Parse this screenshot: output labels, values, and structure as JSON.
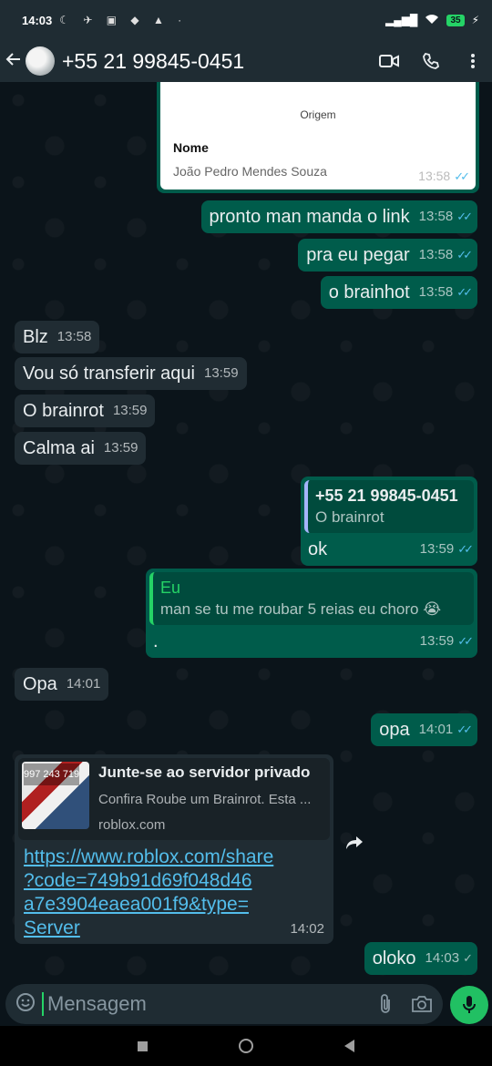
{
  "status_bar": {
    "time": "14:03",
    "battery": "35"
  },
  "header": {
    "contact_name": "+55 21 99845-0451"
  },
  "image_message": {
    "origem_label": "Origem",
    "nome_label": "Nome",
    "nome_value": "João Pedro Mendes Souza",
    "time": "13:58"
  },
  "messages": [
    {
      "text": "pronto man manda o link",
      "time": "13:58",
      "status": "✓✓"
    },
    {
      "text": "pra eu pegar",
      "time": "13:58",
      "status": "✓✓"
    },
    {
      "text": "o brainhot",
      "time": "13:58",
      "status": "✓✓"
    },
    {
      "text": "Blz",
      "time": "13:58"
    },
    {
      "text": "Vou só transferir aqui",
      "time": "13:59"
    },
    {
      "text": "O brainrot",
      "time": "13:59"
    },
    {
      "text": "Calma ai",
      "time": "13:59"
    },
    {
      "quote_name": "+55 21 99845-0451",
      "quote_text": "O brainrot",
      "text": "ok",
      "time": "13:59",
      "status": "✓✓"
    },
    {
      "quote_name": "Eu",
      "quote_text": "man se tu me roubar 5 reias eu choro 😭",
      "text": ".",
      "time": "13:59",
      "status": "✓✓"
    },
    {
      "text": "Opa",
      "time": "14:01"
    },
    {
      "text": "opa",
      "time": "14:01",
      "status": "✓✓"
    },
    {
      "text": "oloko",
      "time": "14:03",
      "status": "✓"
    }
  ],
  "link_message": {
    "preview_title": "Junte-se ao servidor privado",
    "preview_desc": "Confira Roube um Brainrot. Esta ...",
    "preview_domain": "roblox.com",
    "thumb_text": "997 243 719",
    "url_lines": [
      "https://www.roblox.com/share",
      "?code=749b91d69f048d46",
      "a7e3904eaea001f9&type=",
      "Server"
    ],
    "time": "14:02"
  },
  "composer": {
    "placeholder": "Mensagem"
  },
  "colors": {
    "outgoing": "#005c4b",
    "incoming": "#202c33",
    "accent": "#21c063",
    "read_tick": "#53bdeb"
  }
}
